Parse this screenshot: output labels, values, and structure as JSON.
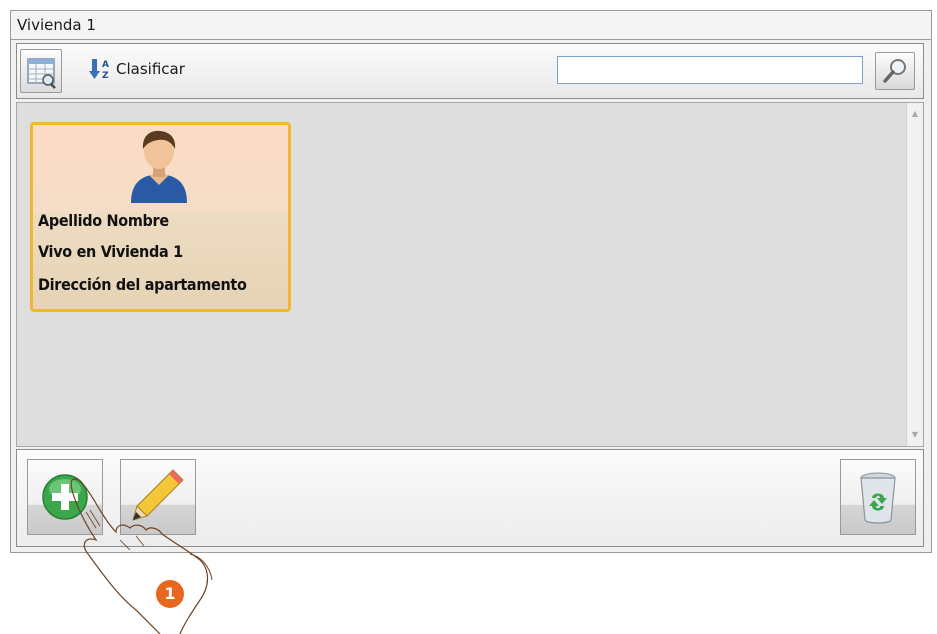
{
  "window": {
    "title": "Vivienda 1"
  },
  "toolbar": {
    "view_icon": "table-view-icon",
    "sort_icon": "sort-az-icon",
    "sort_label": "Clasificar",
    "search_value": "",
    "search_icon": "magnifier-icon"
  },
  "contacts": [
    {
      "avatar_icon": "user-avatar-icon",
      "name_line": "Apellido Nombre",
      "lives_line": "Vivo en  Vivienda 1",
      "address_line": "Dirección del apartamento"
    }
  ],
  "actions": {
    "add_icon": "plus-circle-icon",
    "edit_icon": "pencil-icon",
    "delete_icon": "trash-icon"
  },
  "overlay": {
    "pointer_icon": "hand-pointer-icon",
    "step_number": "1"
  },
  "colors": {
    "selected_border": "#f2b631",
    "card_background": "#fcdcc6",
    "step_badge": "#e8671e",
    "add_green": "#3aa84a"
  }
}
